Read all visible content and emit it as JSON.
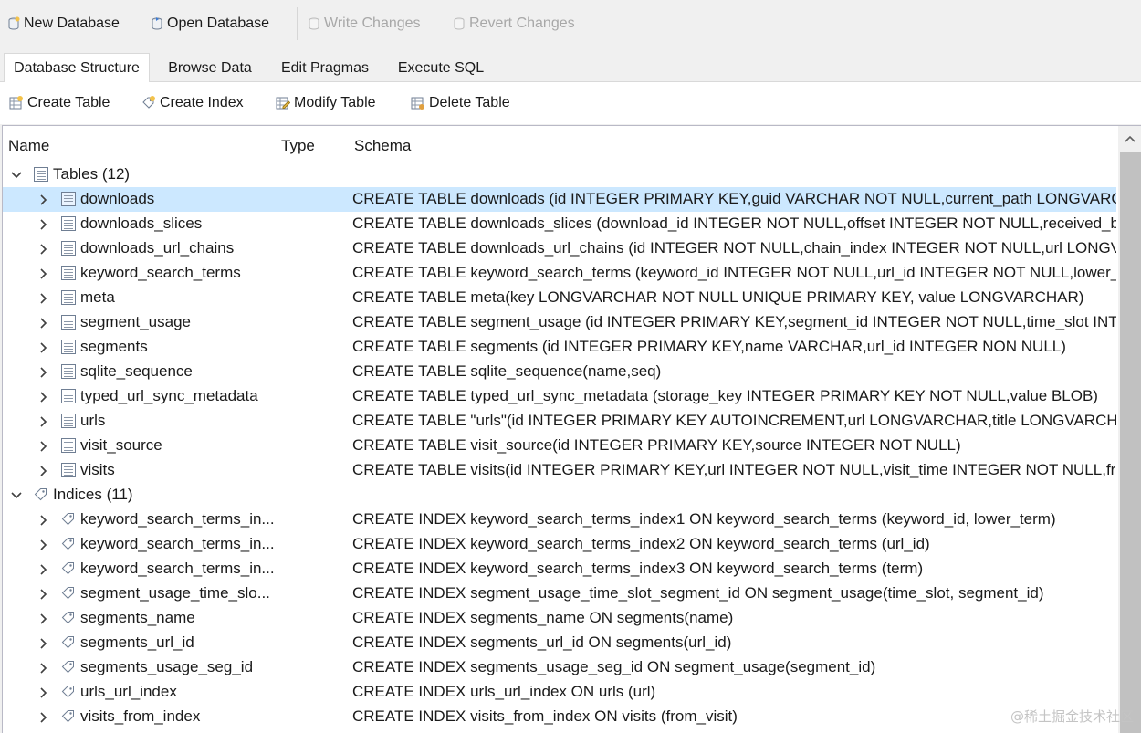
{
  "toolbar": {
    "new_database": "New Database",
    "open_database": "Open Database",
    "write_changes": "Write Changes",
    "revert_changes": "Revert Changes"
  },
  "tabs": [
    "Database Structure",
    "Browse Data",
    "Edit Pragmas",
    "Execute SQL"
  ],
  "subtoolbar": {
    "create_table": "Create Table",
    "create_index": "Create Index",
    "modify_table": "Modify Table",
    "delete_table": "Delete Table"
  },
  "columns": {
    "name": "Name",
    "type": "Type",
    "schema": "Schema"
  },
  "tables_group": "Tables (12)",
  "tables": [
    {
      "name": "downloads",
      "schema": "CREATE TABLE downloads (id INTEGER PRIMARY KEY,guid VARCHAR NOT NULL,current_path LONGVARCH"
    },
    {
      "name": "downloads_slices",
      "schema": "CREATE TABLE downloads_slices (download_id INTEGER NOT NULL,offset INTEGER NOT NULL,received_byte"
    },
    {
      "name": "downloads_url_chains",
      "schema": "CREATE TABLE downloads_url_chains (id INTEGER NOT NULL,chain_index INTEGER NOT NULL,url LONGVARC"
    },
    {
      "name": "keyword_search_terms",
      "schema": "CREATE TABLE keyword_search_terms (keyword_id INTEGER NOT NULL,url_id INTEGER NOT NULL,lower_terr"
    },
    {
      "name": "meta",
      "schema": "CREATE TABLE meta(key LONGVARCHAR NOT NULL UNIQUE PRIMARY KEY, value LONGVARCHAR)"
    },
    {
      "name": "segment_usage",
      "schema": "CREATE TABLE segment_usage (id INTEGER PRIMARY KEY,segment_id INTEGER NOT NULL,time_slot INTEGE"
    },
    {
      "name": "segments",
      "schema": "CREATE TABLE segments (id INTEGER PRIMARY KEY,name VARCHAR,url_id INTEGER NON NULL)"
    },
    {
      "name": "sqlite_sequence",
      "schema": "CREATE TABLE sqlite_sequence(name,seq)"
    },
    {
      "name": "typed_url_sync_metadata",
      "schema": "CREATE TABLE typed_url_sync_metadata (storage_key INTEGER PRIMARY KEY NOT NULL,value BLOB)"
    },
    {
      "name": "urls",
      "schema": "CREATE TABLE \"urls\"(id INTEGER PRIMARY KEY AUTOINCREMENT,url LONGVARCHAR,title LONGVARCHAR,v"
    },
    {
      "name": "visit_source",
      "schema": "CREATE TABLE visit_source(id INTEGER PRIMARY KEY,source INTEGER NOT NULL)"
    },
    {
      "name": "visits",
      "schema": "CREATE TABLE visits(id INTEGER PRIMARY KEY,url INTEGER NOT NULL,visit_time INTEGER NOT NULL,from_v"
    }
  ],
  "indices_group": "Indices (11)",
  "indices": [
    {
      "name": "keyword_search_terms_in...",
      "schema": "CREATE INDEX keyword_search_terms_index1 ON keyword_search_terms (keyword_id, lower_term)"
    },
    {
      "name": "keyword_search_terms_in...",
      "schema": "CREATE INDEX keyword_search_terms_index2 ON keyword_search_terms (url_id)"
    },
    {
      "name": "keyword_search_terms_in...",
      "schema": "CREATE INDEX keyword_search_terms_index3 ON keyword_search_terms (term)"
    },
    {
      "name": "segment_usage_time_slo...",
      "schema": "CREATE INDEX segment_usage_time_slot_segment_id ON segment_usage(time_slot, segment_id)"
    },
    {
      "name": "segments_name",
      "schema": "CREATE INDEX segments_name ON segments(name)"
    },
    {
      "name": "segments_url_id",
      "schema": "CREATE INDEX segments_url_id ON segments(url_id)"
    },
    {
      "name": "segments_usage_seg_id",
      "schema": "CREATE INDEX segments_usage_seg_id ON segment_usage(segment_id)"
    },
    {
      "name": "urls_url_index",
      "schema": "CREATE INDEX urls_url_index ON urls (url)"
    },
    {
      "name": "visits_from_index",
      "schema": "CREATE INDEX visits_from_index ON visits (from_visit)"
    }
  ],
  "watermark": "@稀土掘金技术社区",
  "colors": {
    "selection": "#cce8ff",
    "disabled_text": "#a8a8a8"
  }
}
